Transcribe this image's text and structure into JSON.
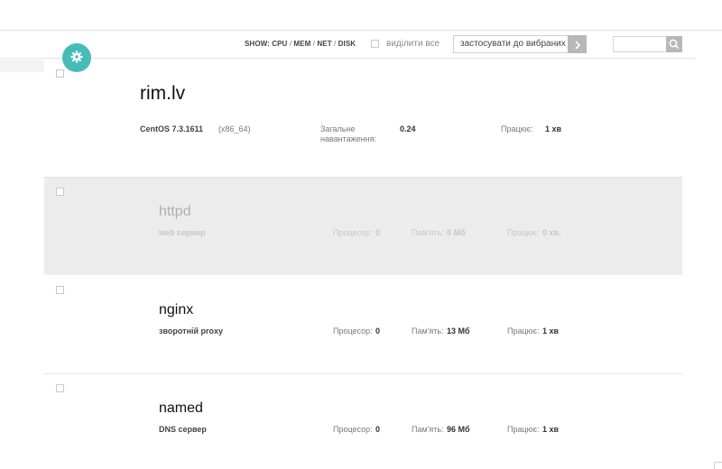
{
  "toolbar": {
    "show_prefix": "SHOW:",
    "show_options": [
      "CPU",
      "MEM",
      "NET",
      "DISK"
    ],
    "show_sep": "/",
    "select_all_label": "виділити все",
    "apply_label": "застосувати до вибраних",
    "apply_icon": "chevron-right-icon",
    "search_placeholder": "",
    "search_icon": "search-icon"
  },
  "gear_icon": "gear-icon",
  "host": {
    "name": "rim.lv",
    "os": "CentOS 7.3.1611",
    "arch": "(x86_64)",
    "load_label": "Загальне навантаження:",
    "load_value": "0.24",
    "uptime_label": "Працює:",
    "uptime_value": "1 хв"
  },
  "services": [
    {
      "name": "httpd",
      "desc": "web сервер",
      "cpu_label": "Процесор:",
      "cpu_value": "0",
      "mem_label": "Пам'ять:",
      "mem_value": "0 Мб",
      "uptime_label": "Працює:",
      "uptime_value": "0 хв.",
      "disabled": true
    },
    {
      "name": "nginx",
      "desc": "зворотній proxy",
      "cpu_label": "Процесор:",
      "cpu_value": "0",
      "mem_label": "Пам'ять:",
      "mem_value": "13 Мб",
      "uptime_label": "Працює:",
      "uptime_value": "1 хв",
      "disabled": false
    },
    {
      "name": "named",
      "desc": "DNS сервер",
      "cpu_label": "Процесор:",
      "cpu_value": "0",
      "mem_label": "Пам'ять:",
      "mem_value": "96 Мб",
      "uptime_label": "Працює:",
      "uptime_value": "1 хв",
      "disabled": false
    }
  ],
  "colors": {
    "accent": "#45bdb6",
    "button_gray": "#b8b8b8",
    "disabled_row_bg": "#ececec"
  }
}
